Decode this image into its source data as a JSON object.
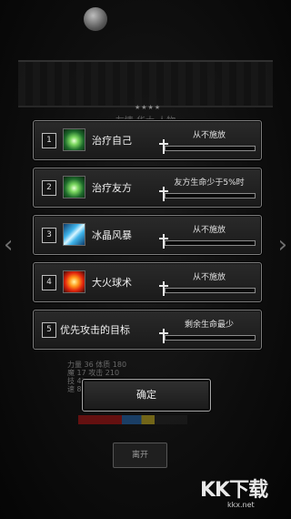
{
  "background": {
    "dialog_title": "友情 华大 人物",
    "stats_lines": [
      "力量 36   体质 180",
      "魔 17   攻击 210",
      "技 45",
      "速 8   ..."
    ],
    "leave_label": "离开"
  },
  "skills": [
    {
      "number": "1",
      "name": "治疗自己",
      "condition": "从不施放",
      "icon": "heal-icon",
      "level": 0.05
    },
    {
      "number": "2",
      "name": "治疗友方",
      "condition": "友方生命少于5%时",
      "icon": "heal-icon",
      "level": 0.05
    },
    {
      "number": "3",
      "name": "冰晶风暴",
      "condition": "从不施放",
      "icon": "ice-storm-icon",
      "level": 0.05
    },
    {
      "number": "4",
      "name": "大火球术",
      "condition": "从不施放",
      "icon": "fireball-icon",
      "level": 0.05
    }
  ],
  "target": {
    "number": "5",
    "name": "优先攻击的目标",
    "condition": "剩余生命最少",
    "level": 0.05
  },
  "confirm_label": "确定",
  "watermark": {
    "text": "KK下载",
    "url": "kkx.net"
  },
  "colors": {
    "panel_border": "#7d7d7d",
    "panel_bg": "#1f1f1f",
    "background": "#0b0b0b"
  }
}
